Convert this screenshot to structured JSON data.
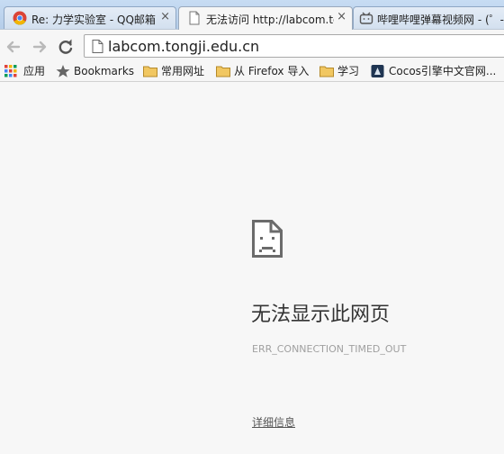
{
  "tabs": [
    {
      "title": "Re: 力学实验室 - QQ邮箱",
      "close": "×",
      "icon": "chrome-icon"
    },
    {
      "title": "无法访问 http://labcom.tongji.edu.cn",
      "close": "×",
      "icon": "page-icon",
      "active": true
    },
    {
      "title": "哔哩哔哩弹幕视频网 - (゜-゜)つロ",
      "icon": "bilibili-tv-icon"
    }
  ],
  "toolbar": {
    "back_icon": "arrow-left-icon",
    "forward_icon": "arrow-right-icon",
    "reload_icon": "reload-icon",
    "address": "labcom.tongji.edu.cn"
  },
  "bookmarks": [
    {
      "label": "应用",
      "icon": "apps-grid-icon"
    },
    {
      "label": "Bookmarks",
      "icon": "star-icon"
    },
    {
      "label": "常用网址",
      "icon": "folder-icon"
    },
    {
      "label": "从 Firefox 导入",
      "icon": "folder-icon"
    },
    {
      "label": "学习",
      "icon": "folder-icon"
    },
    {
      "label": "Cocos引擎中文官网...",
      "icon": "cocos-icon"
    }
  ],
  "error": {
    "icon": "sad-page-icon",
    "title": "无法显示此网页",
    "code": "ERR_CONNECTION_TIMED_OUT",
    "details_link": "详细信息"
  },
  "colors": {
    "titlebar": "#b5cde9",
    "page_background": "#f7f7f7",
    "folder": "#e8b94a"
  }
}
